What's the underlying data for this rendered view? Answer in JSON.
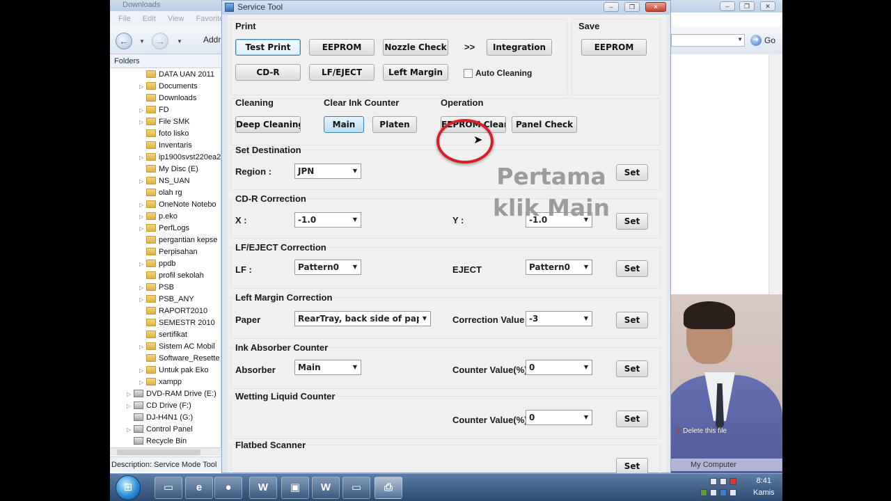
{
  "background_explorer": {
    "title": "Downloads",
    "menu": [
      "File",
      "Edit",
      "View",
      "Favorite"
    ],
    "address_label": "Addr",
    "folders_header": "Folders",
    "tree": [
      {
        "label": "DATA UAN 2011",
        "type": "folder",
        "expandable": false
      },
      {
        "label": "Documents",
        "type": "folder",
        "expandable": true
      },
      {
        "label": "Downloads",
        "type": "folder",
        "expandable": false
      },
      {
        "label": "FD",
        "type": "folder",
        "expandable": true
      },
      {
        "label": "File SMK",
        "type": "folder",
        "expandable": true
      },
      {
        "label": "foto lisko",
        "type": "folder",
        "expandable": false
      },
      {
        "label": "Inventaris",
        "type": "folder",
        "expandable": false
      },
      {
        "label": "ip1900svst220ea2",
        "type": "folder",
        "expandable": true
      },
      {
        "label": "My Disc (E)",
        "type": "folder",
        "expandable": false
      },
      {
        "label": "NS_UAN",
        "type": "folder",
        "expandable": true
      },
      {
        "label": "olah rg",
        "type": "folder",
        "expandable": false
      },
      {
        "label": "OneNote Notebo",
        "type": "folder",
        "expandable": true
      },
      {
        "label": "p.eko",
        "type": "folder",
        "expandable": true
      },
      {
        "label": "PerfLogs",
        "type": "folder",
        "expandable": true
      },
      {
        "label": "pergantian kepse",
        "type": "folder",
        "expandable": false
      },
      {
        "label": "Perpisahan",
        "type": "folder",
        "expandable": false
      },
      {
        "label": "ppdb",
        "type": "folder",
        "expandable": true
      },
      {
        "label": "profil sekolah",
        "type": "folder",
        "expandable": false
      },
      {
        "label": "PSB",
        "type": "folder",
        "expandable": true
      },
      {
        "label": "PSB_ANY",
        "type": "folder",
        "expandable": true
      },
      {
        "label": "RAPORT2010",
        "type": "folder",
        "expandable": false
      },
      {
        "label": "SEMESTR 2010",
        "type": "folder",
        "expandable": false
      },
      {
        "label": "sertifikat",
        "type": "folder",
        "expandable": false
      },
      {
        "label": "Sistem AC Mobil",
        "type": "folder",
        "expandable": true
      },
      {
        "label": "Software_Resette",
        "type": "folder",
        "expandable": false
      },
      {
        "label": "Untuk pak Eko",
        "type": "folder",
        "expandable": true
      },
      {
        "label": "xampp",
        "type": "folder",
        "expandable": true
      },
      {
        "label": "DVD-RAM Drive (E:)",
        "type": "drive",
        "expandable": true
      },
      {
        "label": "CD Drive (F:)",
        "type": "drive",
        "expandable": true
      },
      {
        "label": "DJ-H4N1 (G:)",
        "type": "drive",
        "expandable": false
      },
      {
        "label": "Control Panel",
        "type": "drive",
        "expandable": true
      },
      {
        "label": "Recycle Bin",
        "type": "drive",
        "expandable": false
      }
    ],
    "status_description": "Description: Service Mode Tool"
  },
  "background_explorer_right": {
    "go_label": "Go",
    "delete_hint": "Delete this file",
    "my_computer_tip": "My Computer"
  },
  "service_tool": {
    "title": "Service Tool",
    "print": {
      "title": "Print",
      "buttons": [
        "Test Print",
        "EEPROM",
        "Nozzle Check",
        ">>",
        "Integration",
        "CD-R",
        "LF/EJECT",
        "Left Margin"
      ],
      "auto_cleaning_label": "Auto Cleaning",
      "auto_cleaning_checked": false
    },
    "save": {
      "title": "Save",
      "button": "EEPROM"
    },
    "cleaning": {
      "title": "Cleaning",
      "button": "Deep Cleaning"
    },
    "clear_ink_counter": {
      "title": "Clear Ink Counter",
      "main_button": "Main",
      "platen_button": "Platen"
    },
    "operation": {
      "title": "Operation",
      "eeprom_clear_button": "EEPROM Clear",
      "panel_check_button": "Panel Check"
    },
    "set_destination": {
      "title": "Set Destination",
      "region_label": "Region :",
      "region_value": "JPN",
      "set_button": "Set"
    },
    "cdr_correction": {
      "title": "CD-R Correction",
      "x_label": "X :",
      "x_value": "-1.0",
      "y_label": "Y :",
      "y_value": "-1.0",
      "set_button": "Set"
    },
    "lf_eject_correction": {
      "title": "LF/EJECT Correction",
      "lf_label": "LF :",
      "lf_value": "Pattern0",
      "eject_label": "EJECT",
      "eject_value": "Pattern0",
      "set_button": "Set"
    },
    "left_margin_correction": {
      "title": "Left Margin Correction",
      "paper_label": "Paper",
      "paper_value": "RearTray, back side of paper",
      "correction_label": "Correction Value",
      "correction_value": "-3",
      "set_button": "Set"
    },
    "ink_absorber_counter": {
      "title": "Ink Absorber Counter",
      "absorber_label": "Absorber",
      "absorber_value": "Main",
      "counter_label": "Counter Value(%)",
      "counter_value": "0",
      "set_button": "Set"
    },
    "wetting_liquid_counter": {
      "title": "Wetting Liquid Counter",
      "counter_label": "Counter Value(%)",
      "counter_value": "0",
      "set_button": "Set"
    },
    "flatbed_scanner": {
      "title": "Flatbed Scanner",
      "set_button": "Set"
    }
  },
  "annotation": {
    "line1": "Pertama",
    "line2": "klik Main",
    "ring_color": "#d81f26"
  },
  "taskbar": {
    "start_icon": "windows-orb-icon",
    "items": [
      "explorer-icon",
      "internet-explorer-icon",
      "firefox-icon",
      "word-icon",
      "folder-icon",
      "word-icon",
      "window-icon",
      "service-tool-icon"
    ],
    "clock_time": "8:41",
    "clock_day": "Kamis"
  },
  "colors": {
    "taskbar": "#3f5f88",
    "window_frame": "#bdd1e9",
    "dialog_bg": "#f0f0f0"
  }
}
